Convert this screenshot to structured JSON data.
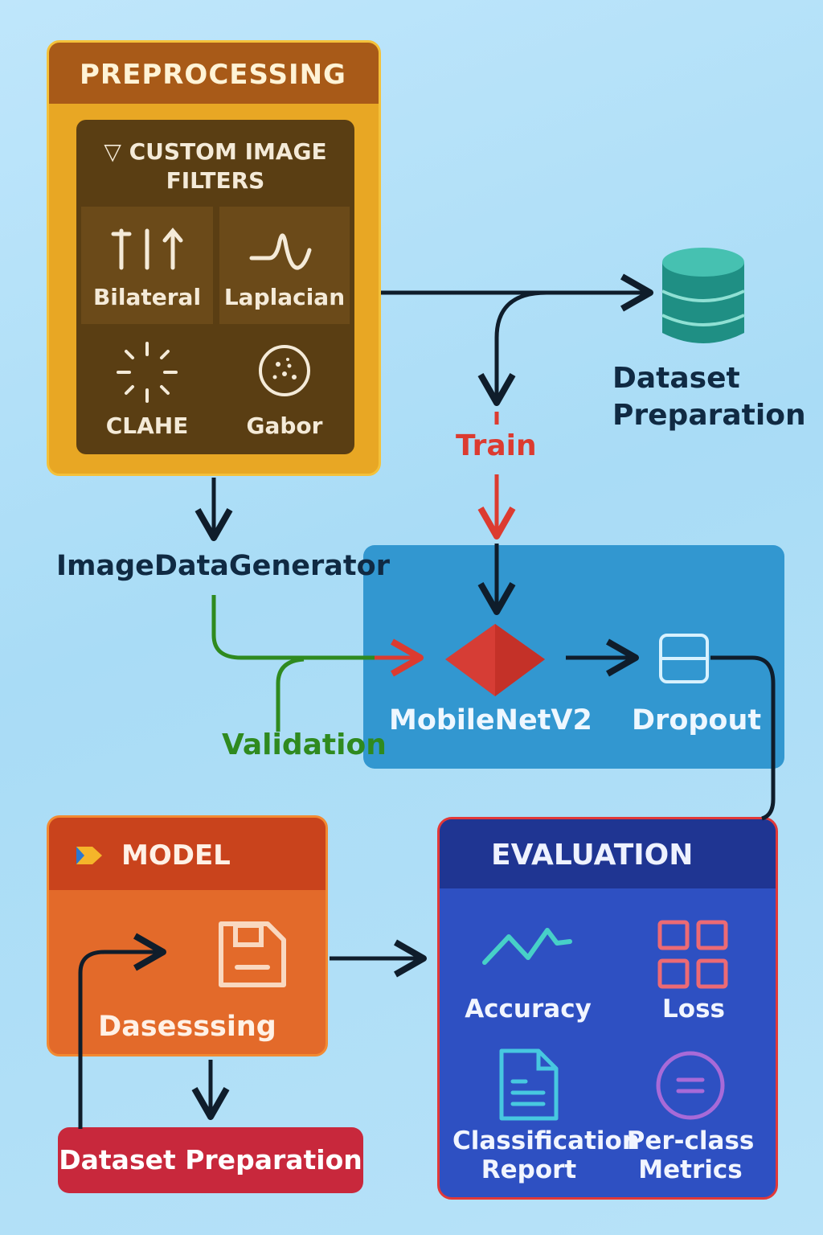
{
  "preprocessing": {
    "title": "PREPROCESSING",
    "filters_title_line1": "▽ CUSTOM IMAGE",
    "filters_title_line2": "FILTERS",
    "filters": [
      {
        "label": "Bilateral",
        "icon": "bilateral-arrows-icon"
      },
      {
        "label": "Laplacian",
        "icon": "laplacian-wave-icon"
      },
      {
        "label": "CLAHE",
        "icon": "burst-icon"
      },
      {
        "label": "Gabor",
        "icon": "dotted-circle-icon"
      }
    ]
  },
  "dataset_top": {
    "line1": "Dataset",
    "line2": "Preparation",
    "icon": "database-icon"
  },
  "flow_labels": {
    "train": "Train",
    "validation": "Validation",
    "image_data_generator": "ImageDataGenerator"
  },
  "architecture": {
    "mobilenet": "MobileNetV2",
    "dropout": "Dropout"
  },
  "model": {
    "title": "MODEL",
    "subtitle": "Dasesssing",
    "icon": "save-icon"
  },
  "dataset_bottom": {
    "label": "Dataset Preparation"
  },
  "evaluation": {
    "title": "EVALUATION",
    "metrics": [
      {
        "line1": "Accuracy",
        "line2": "",
        "icon": "line-chart-icon"
      },
      {
        "line1": "Loss",
        "line2": "",
        "icon": "grid-icon"
      },
      {
        "line1": "Classification",
        "line2": "Report",
        "icon": "document-icon"
      },
      {
        "line1": "Per-class",
        "line2": "Metrics",
        "icon": "circle-equal-icon"
      }
    ]
  },
  "colors": {
    "preprocessing": "#e8a724",
    "model": "#e36a2a",
    "evaluation": "#2e50c2",
    "architecture": "#3297d0",
    "train_arrow": "#dc3b30",
    "validation_arrow": "#2f8a1f",
    "database": "#1f8f84"
  }
}
